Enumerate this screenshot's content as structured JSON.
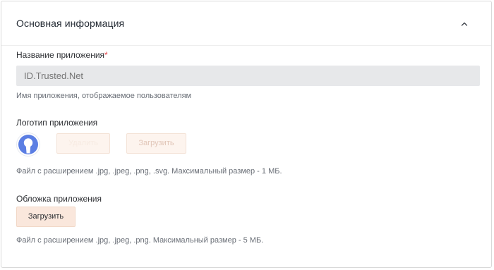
{
  "section": {
    "title": "Основная информация"
  },
  "app_name": {
    "label": "Название приложения",
    "required_mark": "*",
    "placeholder": "ID.Trusted.Net",
    "hint": "Имя приложения, отображаемое пользователям"
  },
  "logo": {
    "label": "Логотип приложения",
    "delete_label": "Удалить",
    "upload_label": "Загрузить",
    "hint": "Файл с расширением .jpg, .jpeg, .png, .svg. Максимальный размер - 1 МБ."
  },
  "cover": {
    "label": "Обложка приложения",
    "upload_label": "Загрузить",
    "hint": "Файл с расширением .jpg, .jpeg, .png. Максимальный размер - 5 МБ."
  },
  "icons": {
    "collapse": "chevron-up-icon",
    "logo": "keyhole-logo-icon"
  },
  "colors": {
    "required": "#e5484d",
    "logo_ring": "#5b7ee3",
    "button_bg": "#fae7dc",
    "button_disabled_bg": "#fdf4ee",
    "input_bg": "#e7e8ea"
  }
}
